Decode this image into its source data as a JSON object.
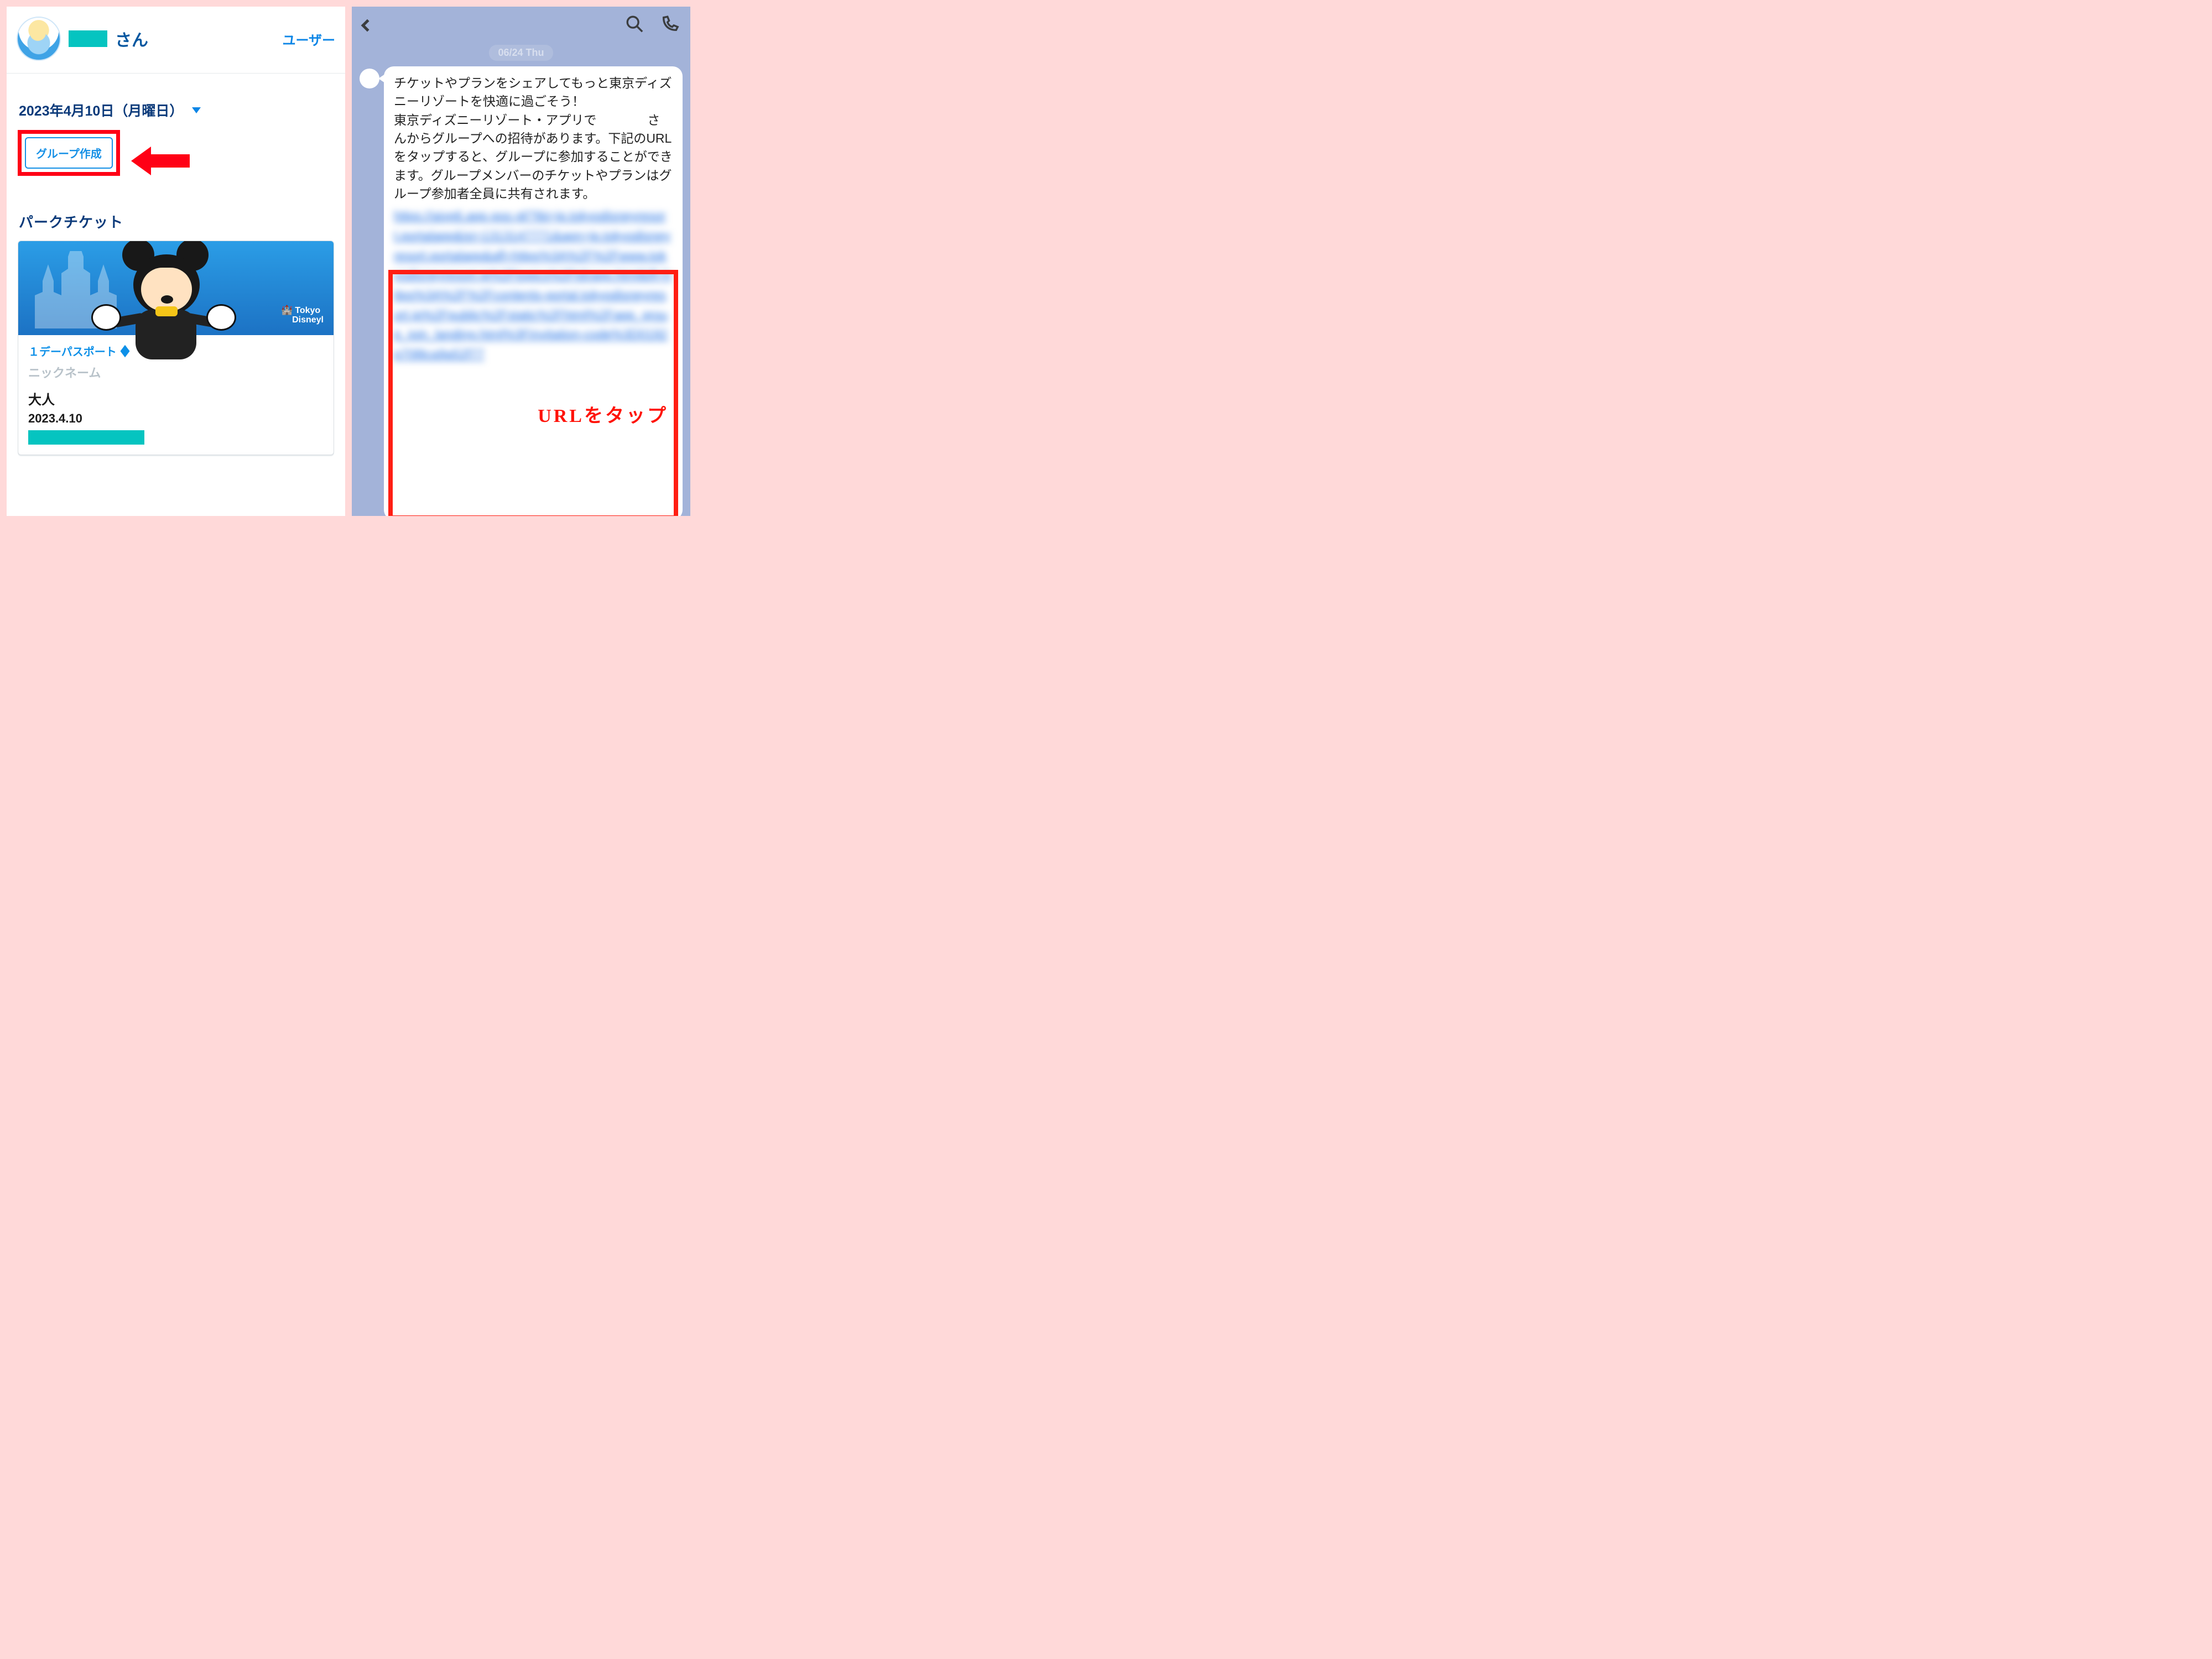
{
  "left": {
    "user_suffix": "さん",
    "user_action_link": "ユーザー",
    "date_label": "2023年4月10日（月曜日）",
    "group_button": "グループ作成",
    "section_title": "パークチケット",
    "ticket": {
      "brand_line1": "Tokyo",
      "brand_line2": "Disneyl",
      "passport": "１デーパスポート",
      "nickname": "ニックネーム",
      "age": "大人",
      "date": "2023.4.10"
    }
  },
  "right": {
    "date_badge": "06/24 Thu",
    "message": "チケットやプランをシェアしてもっと東京ディズニーリゾートを快適に過ごそう！\n東京ディズニーリゾート・アプリで　　　　さんからグループへの招待があります。下記のURLをタップすると、グループに参加することができます。グループメンバーのチケットやプランはグループ参加者全員に共有されます。",
    "url_blur": "https://aivp6.app.goo.gl/?ibi=jp.tokyodisneyresort.portalapp&isi=1313147771&apn=jp.tokyodisneyresort.portalapp&afl=https%3A%2F%2Fwww.tokyodisneyresort.jp%2Ftopics%2Ftdrapp.html&ifl=https%3A%2F%2Fcontents-portal.tokyodisneyresort.jp%2Fpublic%2Fstatic%2Fhtml%2Fapp_group_join_landing.html%3Finvitation-code%3D0192p70l8ca9a52f77",
    "url_annotation": "URLをタップ"
  }
}
